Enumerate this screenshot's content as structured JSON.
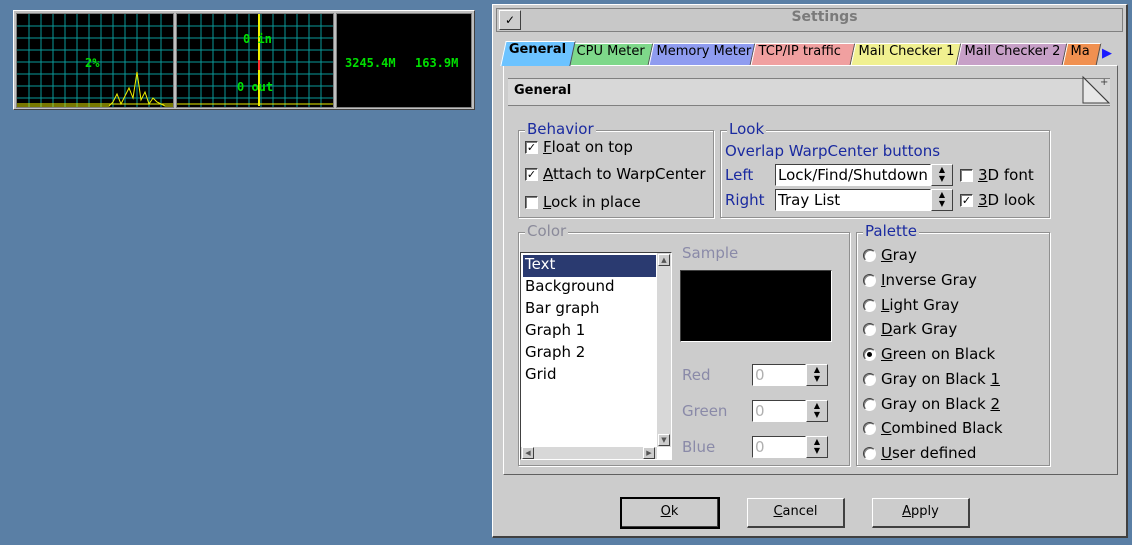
{
  "widget": {
    "cpu_percent": "2%",
    "net_in": "0 in",
    "net_out": "0 out",
    "mem_value_1": "3245.4M",
    "mem_value_2": "163.9M"
  },
  "dialog": {
    "title": "Settings",
    "sysmenu_glyph": "✓",
    "tabs": [
      {
        "label": "General",
        "color": "#6cc3ff",
        "active": true
      },
      {
        "label": "CPU Meter",
        "color": "#7ed88a"
      },
      {
        "label": "Memory Meter",
        "color": "#8f9cf0"
      },
      {
        "label": "TCP/IP traffic",
        "color": "#f0a0a0"
      },
      {
        "label": "Mail Checker 1",
        "color": "#f0f090"
      },
      {
        "label": "Mail Checker 2",
        "color": "#c7a0c7"
      },
      {
        "label": "Ma",
        "color": "#f09050"
      }
    ],
    "tab_scroll_glyph": "▶",
    "page_title": "General",
    "behavior": {
      "title": "Behavior",
      "float_on_top": {
        "pre": "",
        "mn": "F",
        "post": "loat on top",
        "checked": true
      },
      "attach": {
        "pre": "",
        "mn": "A",
        "post": "ttach to WarpCenter",
        "checked": true
      },
      "lock": {
        "pre": "",
        "mn": "L",
        "post": "ock in place",
        "checked": false
      }
    },
    "look": {
      "title": "Look",
      "overlap_label": "Overlap WarpCenter buttons",
      "left_label": "Left",
      "left_value": "Lock/Find/Shutdown",
      "right_label": "Right",
      "right_value": "Tray List",
      "font3d": {
        "mn": "3",
        "post": "D font",
        "checked": false
      },
      "look3d": {
        "mn": "3",
        "post": "D look",
        "checked": true
      }
    },
    "color": {
      "title": "Color",
      "items": [
        "Text",
        "Background",
        "Bar graph",
        "Graph 1",
        "Graph 2",
        "Grid"
      ],
      "selected_index": 0,
      "sample_label": "Sample",
      "red_label": "Red",
      "green_label": "Green",
      "blue_label": "Blue",
      "red_value": "0",
      "green_value": "0",
      "blue_value": "0"
    },
    "palette": {
      "title": "Palette",
      "options": [
        {
          "pre": "",
          "mn": "G",
          "post": "ray",
          "selected": false
        },
        {
          "pre": "",
          "mn": "I",
          "post": "nverse Gray",
          "selected": false
        },
        {
          "pre": "",
          "mn": "L",
          "post": "ight Gray",
          "selected": false
        },
        {
          "pre": "",
          "mn": "D",
          "post": "ark Gray",
          "selected": false
        },
        {
          "pre": "",
          "mn": "G",
          "post": "reen on Black",
          "selected": true
        },
        {
          "pre": "Gray on Black ",
          "mn": "1",
          "post": "",
          "selected": false
        },
        {
          "pre": "Gray on Black ",
          "mn": "2",
          "post": "",
          "selected": false
        },
        {
          "pre": "",
          "mn": "C",
          "post": "ombined Black",
          "selected": false
        },
        {
          "pre": "",
          "mn": "U",
          "post": "ser defined",
          "selected": false
        }
      ]
    },
    "buttons": {
      "ok": {
        "mn": "O",
        "post": "k"
      },
      "cancel": {
        "mn": "C",
        "post": "ancel"
      },
      "apply": {
        "mn": "A",
        "post": "pply"
      }
    }
  }
}
